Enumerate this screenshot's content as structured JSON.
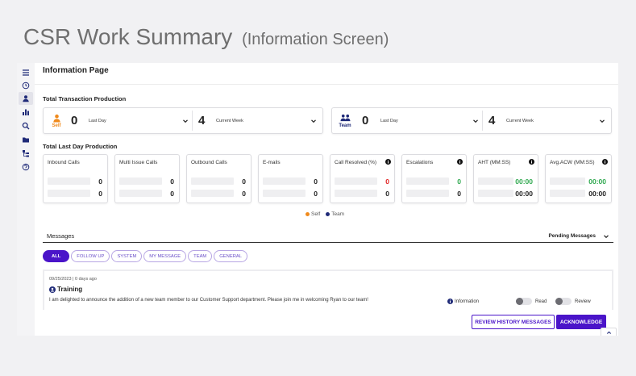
{
  "page": {
    "title": "CSR Work Summary",
    "subtitle": "(Information Screen)",
    "header": "Information Page"
  },
  "colors": {
    "accent": "#4a14c9",
    "self": "#f08a1c",
    "team": "#1f2a78",
    "negative": "#e02020",
    "positive": "#2fa84f"
  },
  "sidebar": {
    "items": [
      {
        "icon": "menu-icon"
      },
      {
        "icon": "clock-icon"
      },
      {
        "icon": "user-icon",
        "active": true
      },
      {
        "icon": "bar-chart-icon"
      },
      {
        "icon": "search-icon"
      },
      {
        "icon": "folder-icon"
      },
      {
        "icon": "hierarchy-icon"
      },
      {
        "icon": "help-icon"
      }
    ]
  },
  "production": {
    "title": "Total Transaction Production",
    "self": {
      "label": "Self",
      "day_value": "0",
      "day_label": "Last Day",
      "week_value": "4",
      "week_label": "Current Week"
    },
    "team": {
      "label": "Team",
      "day_value": "0",
      "day_label": "Last Day",
      "week_value": "4",
      "week_label": "Current Week"
    }
  },
  "last_day": {
    "title": "Total Last Day Production",
    "metrics": [
      {
        "label": "Inbound Calls",
        "self": "0",
        "team": "0",
        "info": false
      },
      {
        "label": "Multi Issue Calls",
        "self": "0",
        "team": "0",
        "info": false
      },
      {
        "label": "Outbound Calls",
        "self": "0",
        "team": "0",
        "info": false
      },
      {
        "label": "E-mails",
        "self": "0",
        "team": "0",
        "info": false
      },
      {
        "label": "Call Resolved (%)",
        "self": "0",
        "team": "0",
        "info": true
      },
      {
        "label": "Escalations",
        "self": "0",
        "team": "0",
        "info": true
      },
      {
        "label": "AHT (MM:SS)",
        "self": "00:00",
        "team": "00:00",
        "info": true
      },
      {
        "label": "Avg.ACW (MM:SS)",
        "self": "00:00",
        "team": "00:00",
        "info": true
      }
    ],
    "legend": {
      "self": "Self",
      "team": "Team"
    }
  },
  "messages": {
    "title": "Messages",
    "dropdown": "Pending Messages",
    "filters": [
      "ALL",
      "FOLLOW UP",
      "SYSTEM",
      "MY MESSAGE",
      "TEAM",
      "GENERAL"
    ],
    "active_filter": "ALL",
    "item": {
      "date": "09/25/2023 | 0 days ago",
      "title": "Training",
      "body": "I am delighted to announce the addition of a new team member to our Customer Support department. Please join me in welcoming Ryan to our team!",
      "tag": "Information",
      "read_label": "Read",
      "review_label": "Review"
    },
    "review_history_button": "REVIEW HISTORY MESSAGES",
    "acknowledge_button": "ACKNOWLEDGE"
  }
}
